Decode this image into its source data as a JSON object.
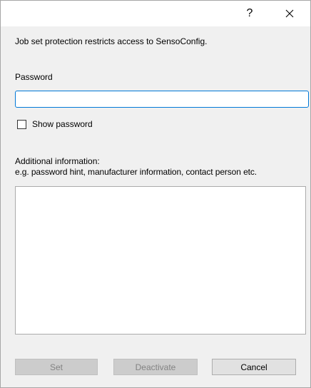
{
  "titlebar": {
    "help_label": "?"
  },
  "dialog": {
    "description": "Job set protection restricts access to SensoConfig.",
    "password_label": "Password",
    "password_value": "",
    "show_password_label": "Show password",
    "show_password_checked": false,
    "additional_info_label": "Additional information:",
    "additional_info_hint": "e.g. password hint, manufacturer information, contact person etc.",
    "additional_info_value": ""
  },
  "buttons": {
    "set_label": "Set",
    "deactivate_label": "Deactivate",
    "cancel_label": "Cancel"
  },
  "icons": {
    "close": "close-icon"
  }
}
